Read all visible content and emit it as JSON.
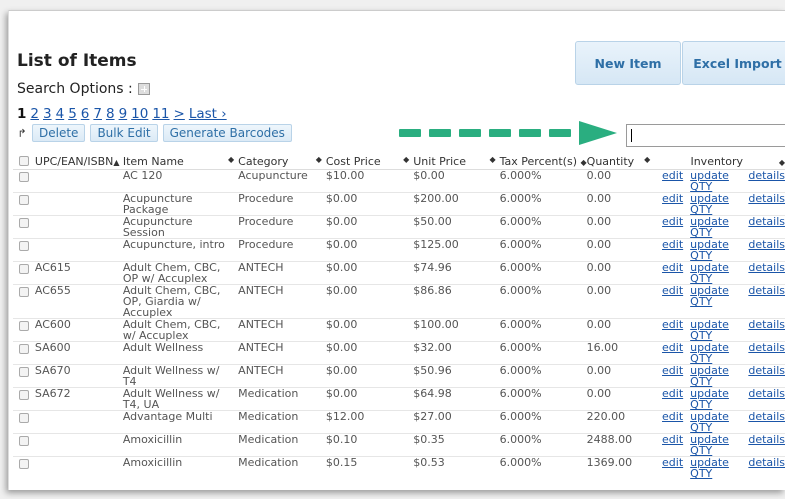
{
  "header": {
    "title": "List of Items",
    "new_item_label": "New Item",
    "excel_import_label": "Excel Import"
  },
  "search": {
    "options_label": "Search Options :",
    "value": ""
  },
  "pagination": {
    "current": "1",
    "pages": [
      "2",
      "3",
      "4",
      "5",
      "6",
      "7",
      "8",
      "9",
      "10",
      "11"
    ],
    "next": ">",
    "last": "Last ›"
  },
  "toolbar": {
    "delete_label": "Delete",
    "bulk_edit_label": "Bulk Edit",
    "generate_barcodes_label": "Generate Barcodes"
  },
  "table": {
    "columns": [
      "UPC/EAN/ISBN",
      "Item Name",
      "Category",
      "Cost Price",
      "Unit Price",
      "Tax Percent(s)",
      "Quantity",
      "",
      "Inventory",
      ""
    ],
    "link_labels": {
      "edit": "edit",
      "update": "update QTY",
      "details": "details"
    },
    "rows": [
      {
        "upc": "",
        "name": "AC 120",
        "category": "Acupuncture",
        "cost": "$10.00",
        "unit": "$0.00",
        "tax": "6.000%",
        "qty": "0.00"
      },
      {
        "upc": "",
        "name": "Acupuncture Package",
        "category": "Procedure",
        "cost": "$0.00",
        "unit": "$200.00",
        "tax": "6.000%",
        "qty": "0.00"
      },
      {
        "upc": "",
        "name": "Acupuncture Session",
        "category": "Procedure",
        "cost": "$0.00",
        "unit": "$50.00",
        "tax": "6.000%",
        "qty": "0.00"
      },
      {
        "upc": "",
        "name": "Acupuncture, intro",
        "category": "Procedure",
        "cost": "$0.00",
        "unit": "$125.00",
        "tax": "6.000%",
        "qty": "0.00"
      },
      {
        "upc": "AC615",
        "name": "Adult Chem, CBC, OP w/ Accuplex",
        "category": "ANTECH",
        "cost": "$0.00",
        "unit": "$74.96",
        "tax": "6.000%",
        "qty": "0.00"
      },
      {
        "upc": "AC655",
        "name": "Adult Chem, CBC, OP, Giardia w/ Accuplex",
        "category": "ANTECH",
        "cost": "$0.00",
        "unit": "$86.86",
        "tax": "6.000%",
        "qty": "0.00"
      },
      {
        "upc": "AC600",
        "name": "Adult Chem, CBC, w/ Accuplex",
        "category": "ANTECH",
        "cost": "$0.00",
        "unit": "$100.00",
        "tax": "6.000%",
        "qty": "0.00"
      },
      {
        "upc": "SA600",
        "name": "Adult Wellness",
        "category": "ANTECH",
        "cost": "$0.00",
        "unit": "$32.00",
        "tax": "6.000%",
        "qty": "16.00"
      },
      {
        "upc": "SA670",
        "name": "Adult Wellness w/ T4",
        "category": "ANTECH",
        "cost": "$0.00",
        "unit": "$50.96",
        "tax": "6.000%",
        "qty": "0.00"
      },
      {
        "upc": "SA672",
        "name": "Adult Wellness w/ T4, UA",
        "category": "Medication",
        "cost": "$0.00",
        "unit": "$64.98",
        "tax": "6.000%",
        "qty": "0.00"
      },
      {
        "upc": "",
        "name": "Advantage Multi",
        "category": "Medication",
        "cost": "$12.00",
        "unit": "$27.00",
        "tax": "6.000%",
        "qty": "220.00"
      },
      {
        "upc": "",
        "name": "Amoxicillin",
        "category": "Medication",
        "cost": "$0.10",
        "unit": "$0.35",
        "tax": "6.000%",
        "qty": "2488.00"
      },
      {
        "upc": "",
        "name": "Amoxicillin",
        "category": "Medication",
        "cost": "$0.15",
        "unit": "$0.53",
        "tax": "6.000%",
        "qty": "1369.00"
      }
    ]
  }
}
